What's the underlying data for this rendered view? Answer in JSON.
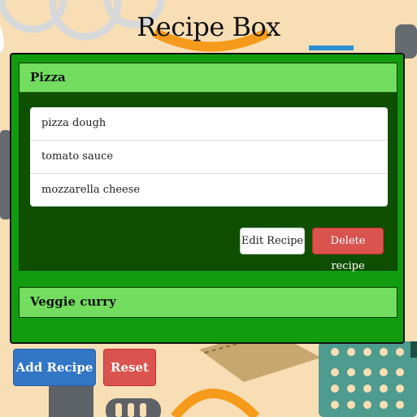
{
  "app": {
    "title": "Recipe Box"
  },
  "recipes": [
    {
      "name": "Pizza",
      "expanded": true,
      "ingredients": [
        "pizza dough",
        "tomato sauce",
        "mozzarella cheese"
      ],
      "edit_label": "Edit Recipe",
      "delete_label": "Delete recipe"
    },
    {
      "name": "Veggie curry",
      "expanded": false
    }
  ],
  "actions": {
    "add_label": "Add Recipe",
    "reset_label": "Reset"
  },
  "colors": {
    "background": "#f8deb5",
    "box_green": "#119c0f",
    "heading_green": "#72dd5f",
    "panel_dark_green": "#0f4f01",
    "primary_blue": "#3276c6",
    "danger_red": "#d9534f"
  }
}
